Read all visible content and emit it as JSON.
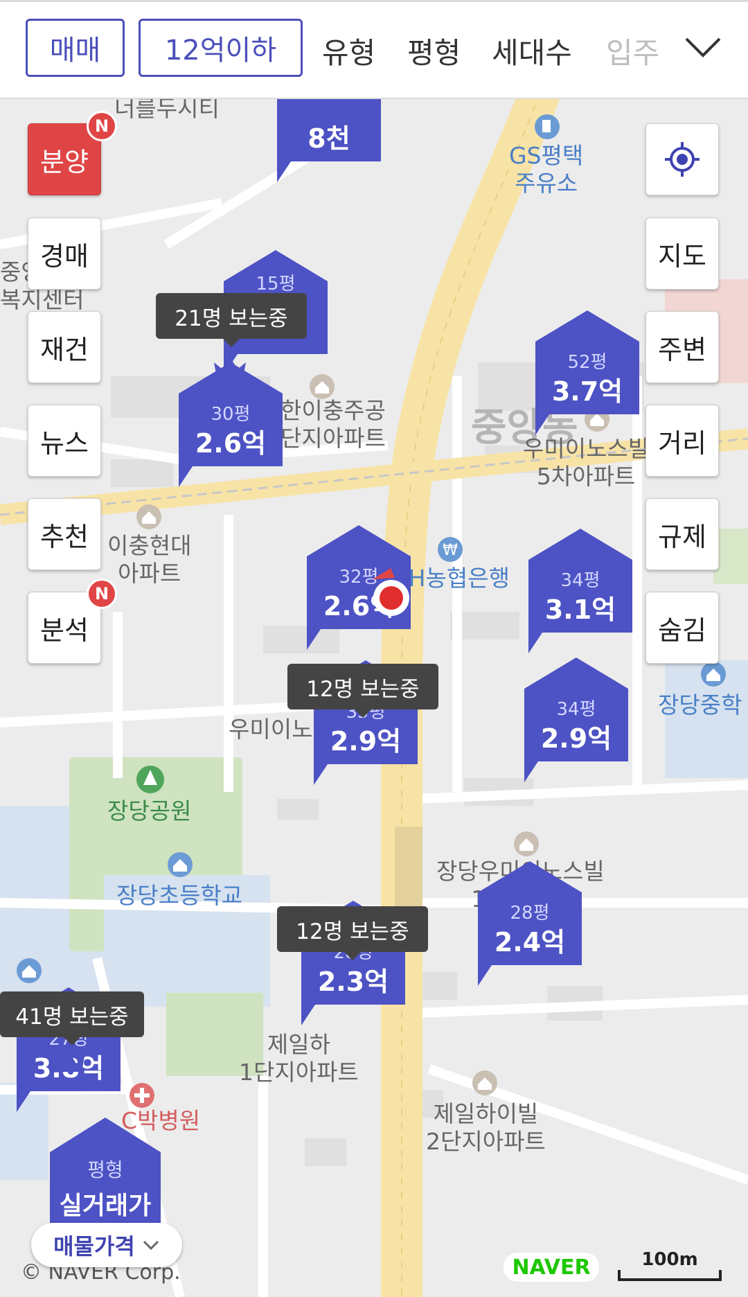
{
  "filters": {
    "chips": [
      "매매",
      "12억이하"
    ],
    "items": [
      "유형",
      "평형",
      "세대수",
      "입주"
    ]
  },
  "map_labels": {
    "top_left_1": "너를두시티",
    "gs_station": "GS평택\n주유소",
    "welfare_center": "중앙\n복지센터",
    "gongdan": "한이충주공\n단지아파트",
    "jungang_dong": "중앙동",
    "umino5": "우미이노스빌\n5차아파트",
    "ichung_hyundai": "이충현대\n아파트",
    "nh_bank": "NH농협은행",
    "umino2": "우미이노스빌2차",
    "jangdang_middle": "장당중학",
    "jangdang_park": "장당공원",
    "jangdang_elem": "장당초등학교",
    "umino1": "장당우미이노스빌\n1차아파트",
    "jeil1": "제일하\n1단지아파트",
    "jeil2": "제일하이빌\n2단지아파트",
    "hospital": "C박병원"
  },
  "side_left": [
    "분양",
    "경매",
    "재건",
    "뉴스",
    "추천",
    "분석"
  ],
  "side_right": [
    "지도",
    "주변",
    "거리",
    "규제",
    "숨김"
  ],
  "badge": "N",
  "markers": [
    {
      "pyeong": "",
      "price": "8천"
    },
    {
      "pyeong": "15평",
      "price": ""
    },
    {
      "pyeong": "30평",
      "price": "2.6억"
    },
    {
      "pyeong": "52평",
      "price": "3.7억"
    },
    {
      "pyeong": "32평",
      "price": "2.6억"
    },
    {
      "pyeong": "34평",
      "price": "3.1억"
    },
    {
      "pyeong": "35평",
      "price": "2.9억"
    },
    {
      "pyeong": "34평",
      "price": "2.9억"
    },
    {
      "pyeong": "28평",
      "price": "2.4억"
    },
    {
      "pyeong": "28평",
      "price": "2.3억"
    },
    {
      "pyeong": "27평",
      "price": "3.8억"
    }
  ],
  "tooltips": [
    "21명 보는중",
    "12명 보는중",
    "12명 보는중",
    "41명 보는중"
  ],
  "legend": {
    "top": "평형",
    "bottom": "실거래가"
  },
  "price_button": "매물가격",
  "copyright": "© NAVER Corp.",
  "naver": "NAVER",
  "scale": "100m",
  "colors": {
    "accent": "#4b4fba",
    "marker": "#4d52c4",
    "red": "#e04545"
  }
}
